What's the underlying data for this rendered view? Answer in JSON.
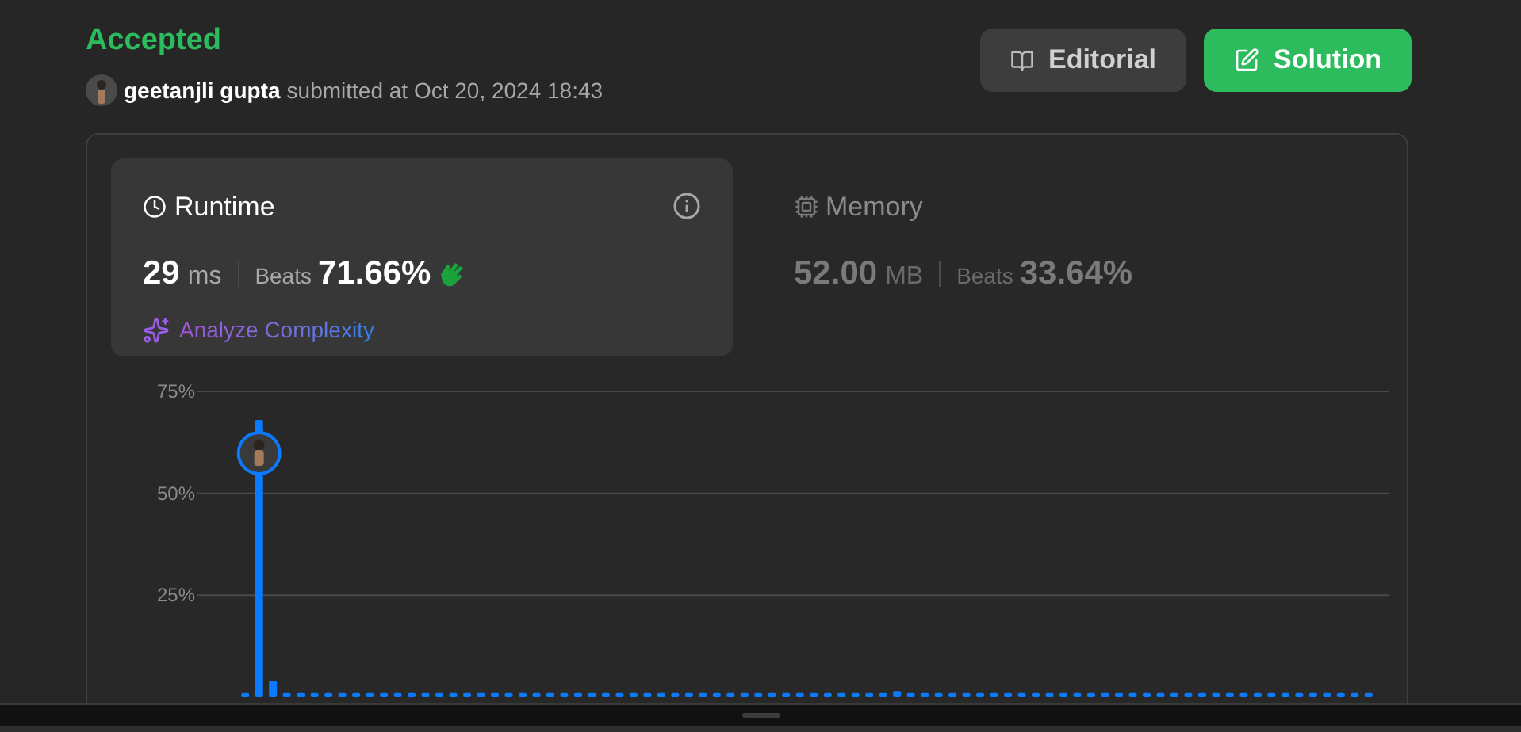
{
  "status": "Accepted",
  "submission": {
    "user": "geetanjli gupta",
    "text": "submitted at Oct 20, 2024 18:43"
  },
  "buttons": [
    {
      "label": "Editorial",
      "kind": "secondary"
    },
    {
      "label": "Solution",
      "kind": "primary"
    }
  ],
  "metrics": [
    {
      "title": "Runtime",
      "selected": true,
      "value": "29",
      "unit": "ms",
      "beats_label": "Beats",
      "beats": "71.66%",
      "link": "Analyze Complexity"
    },
    {
      "title": "Memory",
      "selected": false,
      "value": "52.00",
      "unit": "MB",
      "beats_label": "Beats",
      "beats": "33.64%"
    }
  ],
  "chart": {
    "chart_data": {
      "type": "bar",
      "ylim": [
        0,
        75
      ],
      "yticks": [
        {
          "value": 25,
          "label": "25%"
        },
        {
          "value": 50,
          "label": "50%"
        },
        {
          "value": 75,
          "label": "75%"
        }
      ],
      "values": [
        null,
        null,
        null,
        1,
        68,
        4,
        1,
        1,
        1,
        1,
        1,
        1,
        1,
        1,
        1,
        1,
        1,
        1,
        1,
        1,
        1,
        1,
        1,
        1,
        1,
        1,
        1,
        1,
        1,
        1,
        1,
        1,
        1,
        1,
        1,
        1,
        1,
        1,
        1,
        1,
        1,
        1,
        1,
        1,
        1,
        1,
        1,
        1,
        1,
        1,
        1.5,
        1,
        1,
        1,
        1,
        1,
        1,
        1,
        1,
        1,
        1,
        1,
        1,
        1,
        1,
        1,
        1,
        1,
        1,
        1,
        1,
        1,
        1,
        1,
        1,
        1,
        1,
        1,
        1,
        1,
        1,
        1,
        1,
        1,
        1,
        null
      ]
    }
  }
}
